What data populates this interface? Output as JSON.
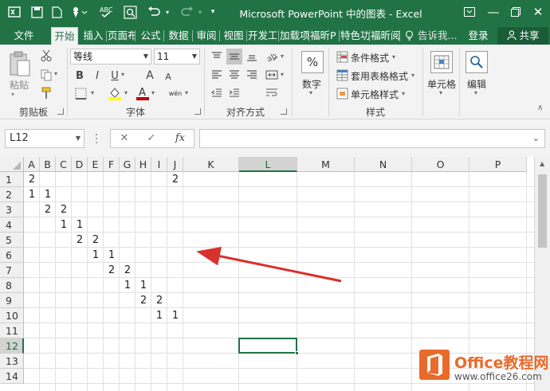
{
  "window": {
    "title": "Microsoft PowerPoint 中的图表 - Excel",
    "controls": [
      "restore-down",
      "minimize",
      "restore",
      "close"
    ]
  },
  "tabs": [
    {
      "label": "文件",
      "active": false
    },
    {
      "label": "开始",
      "active": true
    },
    {
      "label": "插入",
      "active": false
    },
    {
      "label": "页面布",
      "active": false
    },
    {
      "label": "公式",
      "active": false
    },
    {
      "label": "数据",
      "active": false
    },
    {
      "label": "审阅",
      "active": false
    },
    {
      "label": "视图",
      "active": false
    },
    {
      "label": "开发工",
      "active": false
    },
    {
      "label": "加载项",
      "active": false
    },
    {
      "label": "福昕P",
      "active": false
    },
    {
      "label": "特色功",
      "active": false
    },
    {
      "label": "福昕阅",
      "active": false
    }
  ],
  "tellme": "告诉我...",
  "login": "登录",
  "share": "共享",
  "ribbon": {
    "clipboard": {
      "paste": "粘贴",
      "label": "剪贴板"
    },
    "font": {
      "name": "等线",
      "size": "11",
      "label": "字体",
      "bold": "B",
      "italic": "I",
      "underline": "U",
      "grow": "A",
      "shrink": "A",
      "wen": "wén",
      "font_color": "#c00000",
      "fill_color": "#ffff00"
    },
    "alignment": {
      "label": "对齐方式"
    },
    "number": {
      "pct": "%",
      "label": "数字"
    },
    "styles": {
      "cond": "条件格式",
      "table": "套用表格格式",
      "cell_style": "单元格样式",
      "label": "样式"
    },
    "cells": {
      "label": "单元格"
    },
    "editing": {
      "label": "编辑"
    }
  },
  "formula_bar": {
    "name_box": "L12",
    "fx": "fx",
    "formula": ""
  },
  "columns": [
    "A",
    "B",
    "C",
    "D",
    "E",
    "F",
    "G",
    "H",
    "I",
    "J",
    "K",
    "L",
    "M",
    "N",
    "O",
    "P"
  ],
  "rows": [
    "1",
    "2",
    "3",
    "4",
    "5",
    "6",
    "7",
    "8",
    "9",
    "10",
    "11",
    "12",
    "13",
    "14"
  ],
  "active_cell": {
    "col": "L",
    "row": "12"
  },
  "cells": [
    {
      "col": "A",
      "row": "1",
      "value": "2"
    },
    {
      "col": "J",
      "row": "1",
      "value": "2"
    },
    {
      "col": "A",
      "row": "2",
      "value": "1"
    },
    {
      "col": "B",
      "row": "2",
      "value": "1"
    },
    {
      "col": "B",
      "row": "3",
      "value": "2"
    },
    {
      "col": "C",
      "row": "3",
      "value": "2"
    },
    {
      "col": "C",
      "row": "4",
      "value": "1"
    },
    {
      "col": "D",
      "row": "4",
      "value": "1"
    },
    {
      "col": "D",
      "row": "5",
      "value": "2"
    },
    {
      "col": "E",
      "row": "5",
      "value": "2"
    },
    {
      "col": "E",
      "row": "6",
      "value": "1"
    },
    {
      "col": "F",
      "row": "6",
      "value": "1"
    },
    {
      "col": "F",
      "row": "7",
      "value": "2"
    },
    {
      "col": "G",
      "row": "7",
      "value": "2"
    },
    {
      "col": "G",
      "row": "8",
      "value": "1"
    },
    {
      "col": "H",
      "row": "8",
      "value": "1"
    },
    {
      "col": "H",
      "row": "9",
      "value": "2"
    },
    {
      "col": "I",
      "row": "9",
      "value": "2"
    },
    {
      "col": "I",
      "row": "10",
      "value": "1"
    },
    {
      "col": "J",
      "row": "10",
      "value": "1"
    }
  ],
  "annotation_arrow_color": "#d9312b",
  "watermark": {
    "line1": "Office教程网",
    "line2": "www.office26.com",
    "color": "#e96b2c"
  }
}
